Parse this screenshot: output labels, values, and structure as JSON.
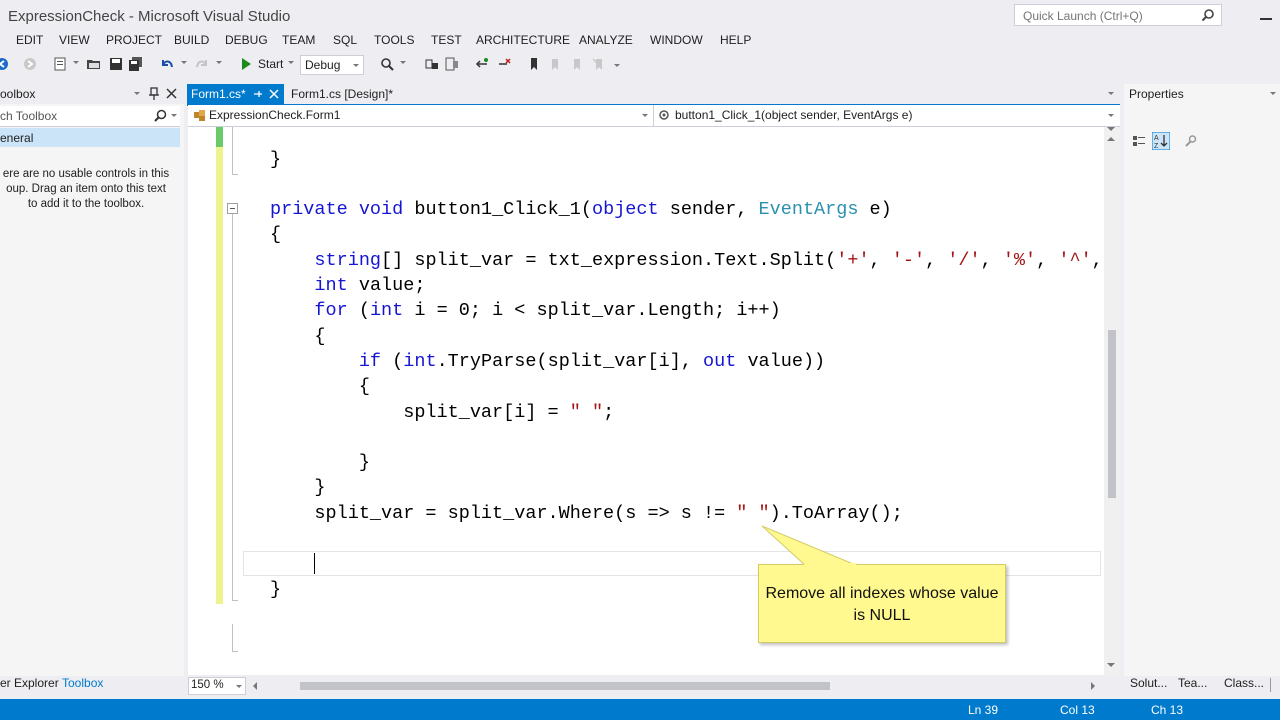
{
  "window": {
    "title": "ExpressionCheck - Microsoft Visual Studio"
  },
  "quick_launch": {
    "placeholder": "Quick Launch (Ctrl+Q)"
  },
  "menu": [
    "EDIT",
    "VIEW",
    "PROJECT",
    "BUILD",
    "DEBUG",
    "TEAM",
    "SQL",
    "TOOLS",
    "TEST",
    "ARCHITECTURE",
    "ANALYZE",
    "WINDOW",
    "HELP"
  ],
  "toolbar": {
    "start_label": "Start",
    "config_value": "Debug"
  },
  "toolbox": {
    "title": "oolbox",
    "search_placeholder": "ch Toolbox",
    "group": "eneral",
    "empty_message": "ere are no usable controls in this oup. Drag an item onto this text to add it to the toolbox."
  },
  "tabs": [
    {
      "label": "Form1.cs*",
      "active": true
    },
    {
      "label": "Form1.cs [Design]*",
      "active": false
    }
  ],
  "navbar": {
    "class": "ExpressionCheck.Form1",
    "method": "button1_Click_1(object sender, EventArgs e)"
  },
  "code_lines": [
    "}",
    "",
    "private void button1_Click_1(object sender, EventArgs e)",
    "{",
    "    string[] split_var = txt_expression.Text.Split('+', '-', '/', '%', '^',",
    "    int value;",
    "    for (int i = 0; i < split_var.Length; i++)",
    "    {",
    "        if (int.TryParse(split_var[i], out value))",
    "        {",
    "            split_var[i] = \" \";",
    "",
    "        }",
    "    }",
    "    split_var = split_var.Where(s => s != \" \").ToArray();",
    "",
    "}"
  ],
  "callout": {
    "text": "Remove all indexes whose value is NULL"
  },
  "editor": {
    "zoom": "150 %"
  },
  "properties": {
    "title": "Properties"
  },
  "bottom_tabs_left": [
    "er Explorer",
    "Toolbox"
  ],
  "bottom_tabs_right": [
    "Solut...",
    "Tea...",
    "Class..."
  ],
  "status": {
    "ln": "Ln 39",
    "col": "Col 13",
    "ch": "Ch 13"
  },
  "colors": {
    "accent": "#007acc",
    "keyword": "#1515d4",
    "type": "#2b91af",
    "string": "#a31515",
    "callout": "#fff98f"
  }
}
